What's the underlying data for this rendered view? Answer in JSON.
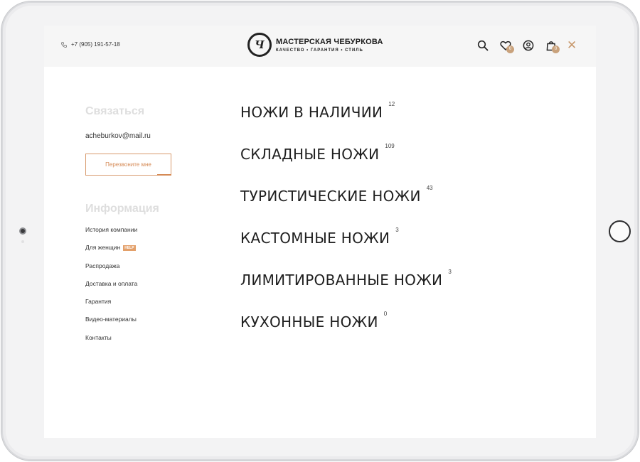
{
  "header": {
    "phone": "+7 (905) 191-57-18",
    "logo_mark": "Ч",
    "logo_title": "МАСТЕРСКАЯ ЧЕБУРКОВА",
    "logo_tagline": "КАЧЕСТВО • ГАРАНТИЯ • СТИЛЬ",
    "favorites_count": "0",
    "cart_count": "0",
    "close_symbol": "✕"
  },
  "contact": {
    "title": "Связаться",
    "email": "acheburkov@mail.ru",
    "callback_label": "Перезвоните мне"
  },
  "info": {
    "title": "Информация",
    "links": [
      {
        "label": "История компании"
      },
      {
        "label": "Для женщин",
        "badge": "HELP"
      },
      {
        "label": "Распродажа"
      },
      {
        "label": "Доставка и оплата"
      },
      {
        "label": "Гарантия"
      },
      {
        "label": "Видео-материалы"
      },
      {
        "label": "Контакты"
      }
    ]
  },
  "categories": [
    {
      "name": "НОЖИ В НАЛИЧИИ",
      "count": "12"
    },
    {
      "name": "СКЛАДНЫЕ НОЖИ",
      "count": "109"
    },
    {
      "name": "ТУРИСТИЧЕСКИЕ НОЖИ",
      "count": "43"
    },
    {
      "name": "КАСТОМНЫЕ НОЖИ",
      "count": "3"
    },
    {
      "name": "ЛИМИТИРОВАННЫЕ НОЖИ",
      "count": "3"
    },
    {
      "name": "КУХОННЫЕ НОЖИ",
      "count": "0"
    }
  ],
  "icons": {
    "phone": "phone-icon",
    "search": "search-icon",
    "favorites": "heart-icon",
    "account": "user-icon",
    "cart": "bag-icon",
    "close": "close-icon"
  },
  "colors": {
    "accent": "#c9a27c",
    "button_border": "#d89a6d",
    "muted_title": "#dedede"
  }
}
